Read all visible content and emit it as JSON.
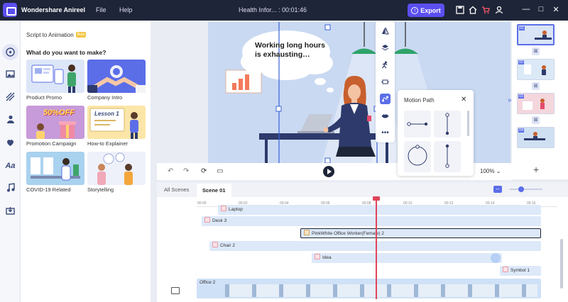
{
  "app": {
    "name": "Wondershare Anireel",
    "menu": [
      "File",
      "Help"
    ],
    "doc_title": "Health Infor... : 00:01:46",
    "export_label": "Export"
  },
  "panel": {
    "script_label": "Script to Animation",
    "badge": "Beta",
    "heading": "What do you want to make?",
    "templates": [
      {
        "label": "Product Promo"
      },
      {
        "label": "Company Intro"
      },
      {
        "label": "Promotion Campaign",
        "art_text": "50%OFF"
      },
      {
        "label": "How-to Explainer",
        "art_text": "Lesson 1"
      },
      {
        "label": "COVID-19 Related"
      },
      {
        "label": "Storytelling"
      }
    ]
  },
  "canvas": {
    "bubble_text": "Working long hours is exhausting…",
    "zoom": "100%"
  },
  "motion_path": {
    "title": "Motion Path",
    "close": "✕"
  },
  "scenes": [
    "01",
    "02",
    "03",
    "04"
  ],
  "timeline": {
    "tabs": [
      "All Scenes",
      "Scene 01"
    ],
    "ticks": [
      "00:00",
      "00:02",
      "00:04",
      "00:06",
      "00:08",
      "00:10",
      "00:12",
      "00:14",
      "00:16"
    ],
    "tracks": [
      {
        "label": "Laptop"
      },
      {
        "label": "Desk 3"
      },
      {
        "label": "PinkWhite Office Worker(Female) 2"
      },
      {
        "label": "Chair 2"
      },
      {
        "label": "Idea"
      },
      {
        "label": "Symbol 1"
      },
      {
        "label": "Office 2"
      }
    ]
  }
}
